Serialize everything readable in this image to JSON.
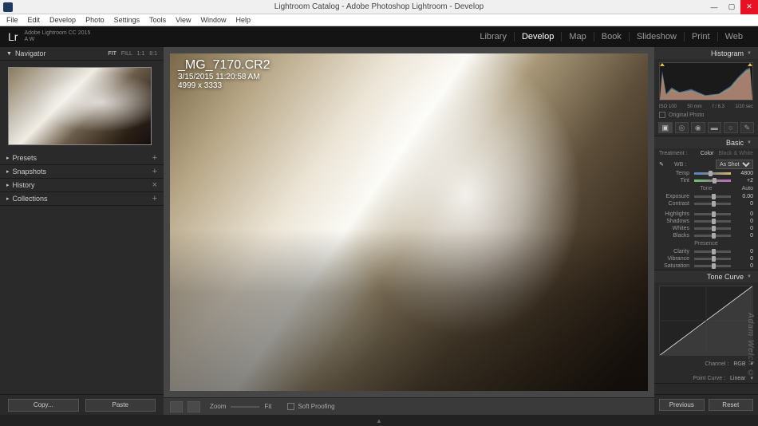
{
  "window": {
    "title": "Lightroom Catalog - Adobe Photoshop Lightroom - Develop"
  },
  "menubar": [
    "File",
    "Edit",
    "Develop",
    "Photo",
    "Settings",
    "Tools",
    "View",
    "Window",
    "Help"
  ],
  "header": {
    "logo": "Lr",
    "version_line1": "Adobe Lightroom CC 2015",
    "version_line2": "A W",
    "nav": [
      "Library",
      "Develop",
      "Map",
      "Book",
      "Slideshow",
      "Print",
      "Web"
    ],
    "active_nav": "Develop"
  },
  "left": {
    "navigator": {
      "title": "Navigator",
      "fit": "FIT",
      "fill": "FILL",
      "r1": "1:1",
      "r2": "8:1"
    },
    "panels": [
      {
        "title": "Presets",
        "btn": "+"
      },
      {
        "title": "Snapshots",
        "btn": "+"
      },
      {
        "title": "History",
        "btn": "×"
      },
      {
        "title": "Collections",
        "btn": "+"
      }
    ],
    "copy": "Copy...",
    "paste": "Paste"
  },
  "image": {
    "filename": "_MG_7170.CR2",
    "timestamp": "3/15/2015 11:20:58 AM",
    "dimensions": "4999 x 3333"
  },
  "toolbar": {
    "zoom": "Zoom",
    "fit": "Fit",
    "soft_proofing": "Soft Proofing"
  },
  "right": {
    "histogram_title": "Histogram",
    "hist_meta": {
      "iso": "ISO 100",
      "focal": "50 mm",
      "aperture": "f / 6.3",
      "shutter": "1/10 sec"
    },
    "original_photo": "Original Photo",
    "basic_title": "Basic",
    "treatment": {
      "label": "Treatment :",
      "color": "Color",
      "bw": "Black & White"
    },
    "wb": {
      "label": "WB :",
      "value": "As Shot"
    },
    "temp": {
      "label": "Temp",
      "value": "4800"
    },
    "tint": {
      "label": "Tint",
      "value": "+2"
    },
    "tone_header": "Tone",
    "auto": "Auto",
    "exposure": {
      "label": "Exposure",
      "value": "0.00"
    },
    "contrast": {
      "label": "Contrast",
      "value": "0"
    },
    "highlights": {
      "label": "Highlights",
      "value": "0"
    },
    "shadows": {
      "label": "Shadows",
      "value": "0"
    },
    "whites": {
      "label": "Whites",
      "value": "0"
    },
    "blacks": {
      "label": "Blacks",
      "value": "0"
    },
    "presence_header": "Presence",
    "clarity": {
      "label": "Clarity",
      "value": "0"
    },
    "vibrance": {
      "label": "Vibrance",
      "value": "0"
    },
    "saturation": {
      "label": "Saturation",
      "value": "0"
    },
    "tone_curve_title": "Tone Curve",
    "channel": {
      "label": "Channel :",
      "value": "RGB"
    },
    "point_curve": {
      "label": "Point Curve :",
      "value": "Linear"
    },
    "previous": "Previous",
    "reset": "Reset"
  },
  "watermark": "Adam Welch ©"
}
